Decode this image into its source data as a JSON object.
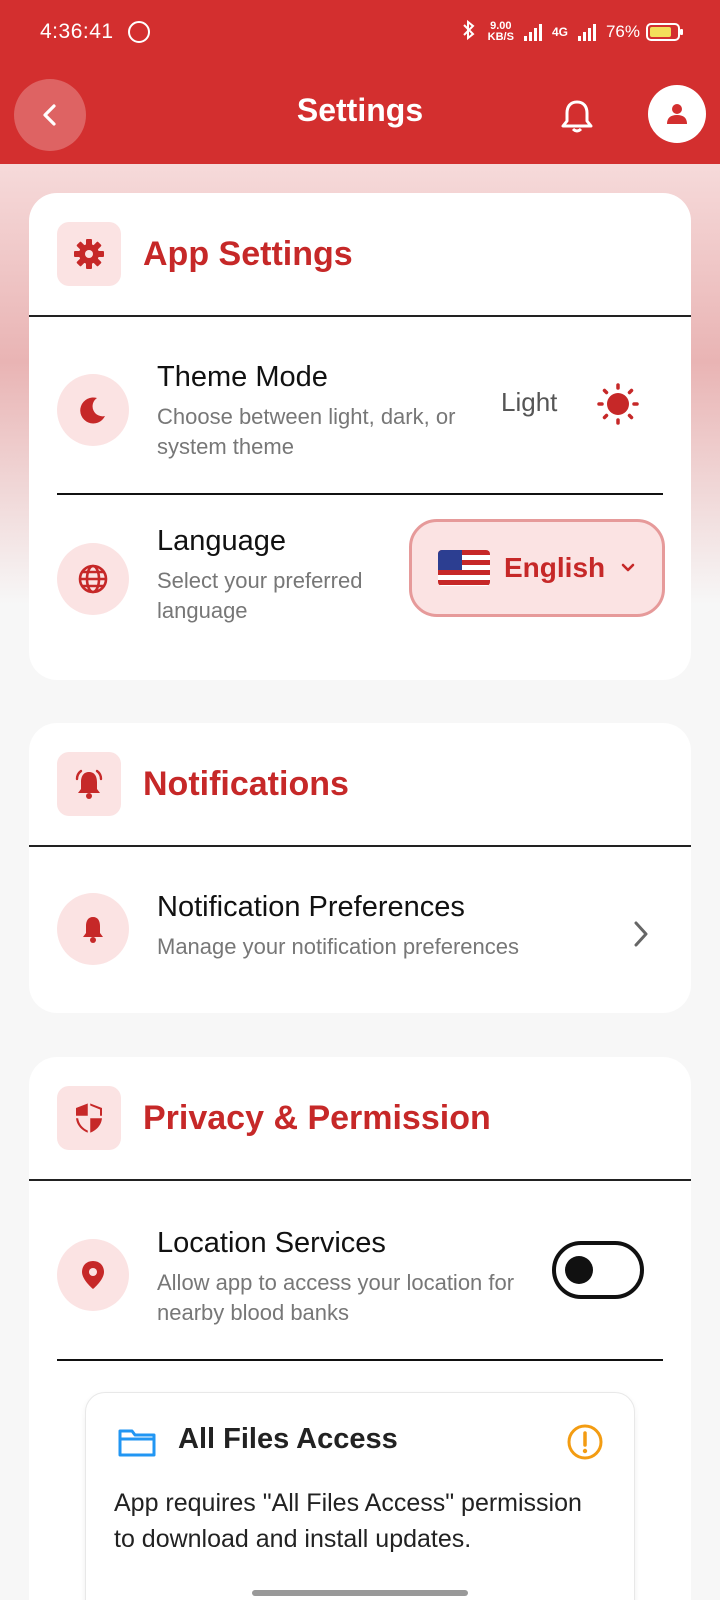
{
  "status_bar": {
    "time": "4:36:41",
    "speed_top": "9.00",
    "speed_bottom": "KB/S",
    "network": "4G",
    "battery": "76%",
    "battery_level": 0.76
  },
  "header": {
    "title": "Settings",
    "back_icon": "chevron-left-icon",
    "bell_icon": "bell-icon",
    "avatar_icon": "person-icon"
  },
  "app_settings": {
    "title": "App Settings",
    "theme": {
      "title": "Theme Mode",
      "subtitle": "Choose between light, dark, or system theme",
      "value": "Light"
    },
    "language": {
      "title": "Language",
      "subtitle": "Select your preferred language",
      "selected": "English"
    }
  },
  "notifications": {
    "title": "Notifications",
    "preferences": {
      "title": "Notification Preferences",
      "subtitle": "Manage your notification preferences"
    }
  },
  "privacy": {
    "title": "Privacy & Permission",
    "location": {
      "title": "Location Services",
      "subtitle": "Allow app to access your location for nearby blood banks",
      "enabled": false
    },
    "files": {
      "title": "All Files Access",
      "description": "App requires \"All Files Access\" permission to download and install updates."
    }
  },
  "colors": {
    "primary": "#d32f2f",
    "accent_text": "#c62828",
    "icon_bg": "#fbe3e3",
    "warning": "#f39c12",
    "folder": "#2196f3"
  }
}
